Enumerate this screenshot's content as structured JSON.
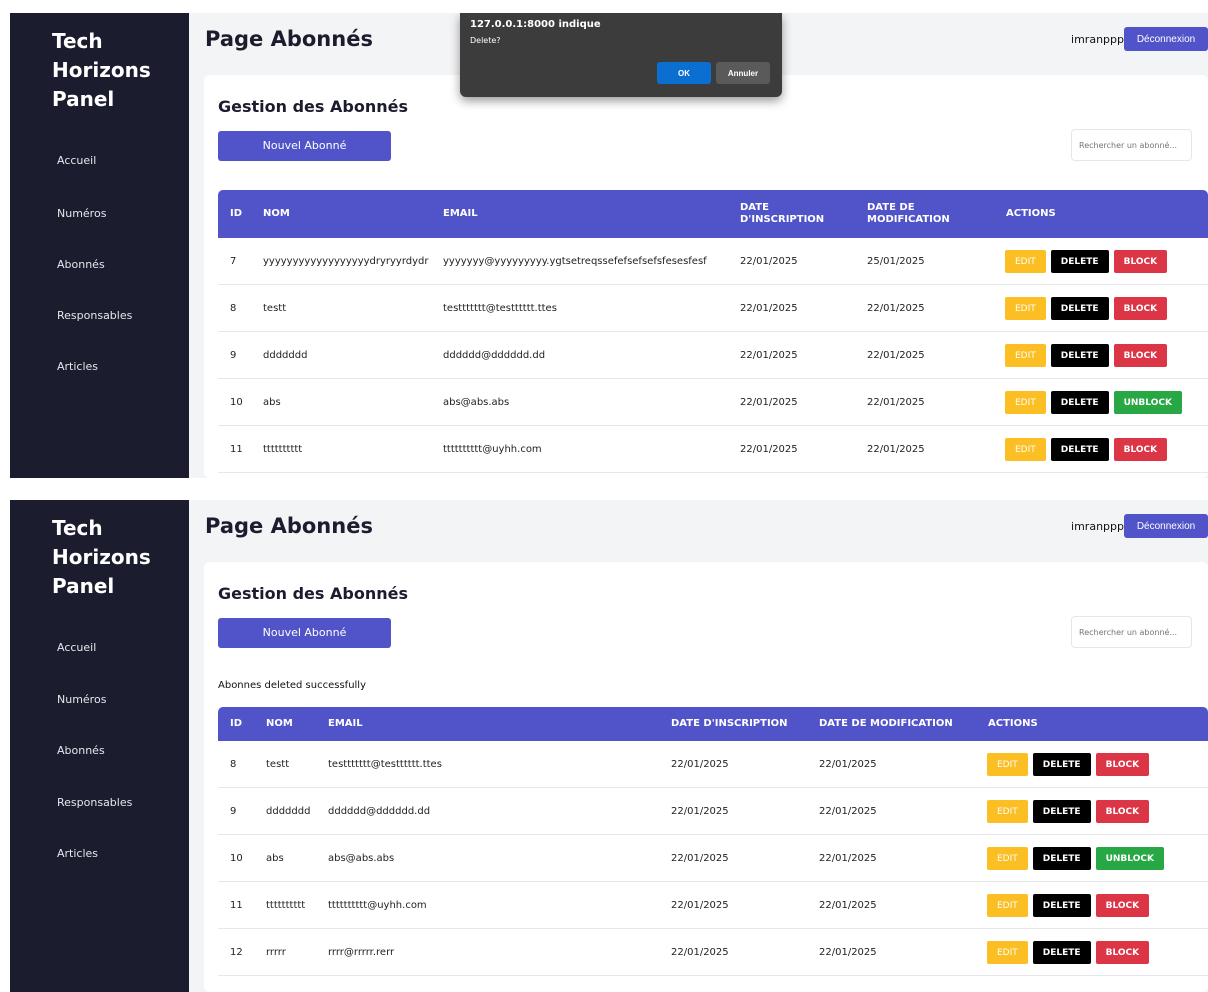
{
  "sidebar": {
    "brand": "Tech Horizons Panel",
    "items": [
      "Accueil",
      "Numéros",
      "Abonnés",
      "Responsables",
      "Articles"
    ]
  },
  "header": {
    "title": "Page Abonnés",
    "user": "imranppp",
    "logout_label": "Déconnexion"
  },
  "main": {
    "title": "Gestion des Abonnés",
    "new_button_label": "Nouvel Abonné",
    "search_placeholder": "Rechercher un abonné..."
  },
  "dialog": {
    "title": "127.0.0.1:8000 indique",
    "message": "Delete?",
    "ok_label": "OK",
    "cancel_label": "Annuler"
  },
  "table": {
    "headers_first": [
      "ID",
      "NOM",
      "EMAIL",
      "DATE D'INSCRIPTION",
      "DATE DE MODIFICATION",
      "ACTIONS"
    ],
    "headers_second": [
      "ID",
      "NOM",
      "EMAIL",
      "DATE D'INSCRIPTION",
      "DATE DE MODIFICATION",
      "ACTIONS"
    ],
    "action_labels": {
      "edit": "EDIT",
      "delete": "DELETE",
      "block": "BLOCK",
      "unblock": "UNBLOCK"
    },
    "rows_first": [
      {
        "id": "7",
        "nom": "yyyyyyyyyyyyyyyyyydryryyrdydr",
        "email": "yyyyyyy@yyyyyyyyy.ygtsetreqssefefsefsefsfesesfesf",
        "date_inscription": "22/01/2025",
        "date_modification": "25/01/2025",
        "status_action": "BLOCK"
      },
      {
        "id": "8",
        "nom": "testt",
        "email": "testtttttt@testttttt.ttes",
        "date_inscription": "22/01/2025",
        "date_modification": "22/01/2025",
        "status_action": "BLOCK"
      },
      {
        "id": "9",
        "nom": "ddddddd",
        "email": "dddddd@dddddd.dd",
        "date_inscription": "22/01/2025",
        "date_modification": "22/01/2025",
        "status_action": "BLOCK"
      },
      {
        "id": "10",
        "nom": "abs",
        "email": "abs@abs.abs",
        "date_inscription": "22/01/2025",
        "date_modification": "22/01/2025",
        "status_action": "UNBLOCK"
      },
      {
        "id": "11",
        "nom": "tttttttttt",
        "email": "tttttttttt@uyhh.com",
        "date_inscription": "22/01/2025",
        "date_modification": "22/01/2025",
        "status_action": "BLOCK"
      }
    ],
    "flash_message": "Abonnes deleted successfully",
    "rows_second": [
      {
        "id": "8",
        "nom": "testt",
        "email": "testtttttt@testttttt.ttes",
        "date_inscription": "22/01/2025",
        "date_modification": "22/01/2025",
        "status_action": "BLOCK"
      },
      {
        "id": "9",
        "nom": "ddddddd",
        "email": "dddddd@dddddd.dd",
        "date_inscription": "22/01/2025",
        "date_modification": "22/01/2025",
        "status_action": "BLOCK"
      },
      {
        "id": "10",
        "nom": "abs",
        "email": "abs@abs.abs",
        "date_inscription": "22/01/2025",
        "date_modification": "22/01/2025",
        "status_action": "UNBLOCK"
      },
      {
        "id": "11",
        "nom": "tttttttttt",
        "email": "tttttttttt@uyhh.com",
        "date_inscription": "22/01/2025",
        "date_modification": "22/01/2025",
        "status_action": "BLOCK"
      },
      {
        "id": "12",
        "nom": "rrrrr",
        "email": "rrrr@rrrrr.rerr",
        "date_inscription": "22/01/2025",
        "date_modification": "22/01/2025",
        "status_action": "BLOCK"
      }
    ]
  },
  "colors": {
    "sidebar_bg": "#1c1c2f",
    "accent": "#5154c8",
    "edit": "#fbbf24",
    "delete": "#000000",
    "block": "#dc3545",
    "unblock": "#28a745"
  }
}
